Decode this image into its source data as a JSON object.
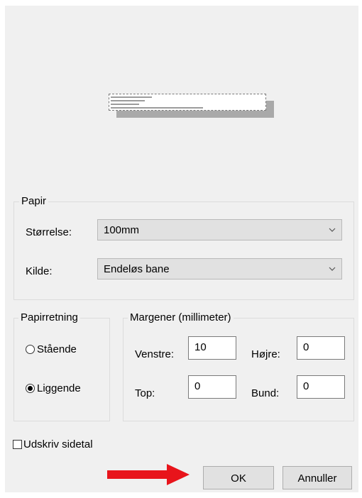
{
  "paper": {
    "group_label": "Papir",
    "size_label": "Størrelse:",
    "size_value": "100mm",
    "source_label": "Kilde:",
    "source_value": "Endeløs bane"
  },
  "orientation": {
    "group_label": "Papirretning",
    "portrait_label": "Stående",
    "landscape_label": "Liggende",
    "selected": "landscape"
  },
  "margins": {
    "group_label": "Margener (millimeter)",
    "left_label": "Venstre:",
    "left_value": "10",
    "right_label": "Højre:",
    "right_value": "0",
    "top_label": "Top:",
    "top_value": "0",
    "bottom_label": "Bund:",
    "bottom_value": "0"
  },
  "print_page_numbers": {
    "label": "Udskriv sidetal",
    "checked": false
  },
  "buttons": {
    "ok_label": "OK",
    "cancel_label": "Annuller"
  },
  "colors": {
    "arrow": "#e8141b",
    "dialog_bg": "#f0f0f0"
  }
}
